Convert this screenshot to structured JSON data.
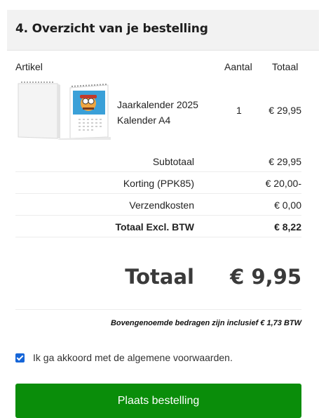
{
  "section": {
    "title": "4. Overzicht van je bestelling"
  },
  "table": {
    "headers": {
      "article": "Artikel",
      "quantity": "Aantal",
      "total": "Totaal"
    },
    "items": [
      {
        "name_line1": "Jaarkalender 2025",
        "name_line2": "Kalender A4",
        "quantity": "1",
        "price": "€ 29,95",
        "image": "wall-calendar-thumbnail"
      }
    ]
  },
  "summary": {
    "subtotal_label": "Subtotaal",
    "subtotal_value": "€ 29,95",
    "discount_label": "Korting (PPK85)",
    "discount_value": "€ 20,00-",
    "shipping_label": "Verzendkosten",
    "shipping_value": "€ 0,00",
    "excl_vat_label": "Totaal Excl. BTW",
    "excl_vat_value": "€ 8,22",
    "total_label": "Totaal",
    "total_value": "€ 9,95"
  },
  "vat_note": "Bovengenoemde bedragen zijn inclusief € 1,73 BTW",
  "terms": {
    "label": "Ik ga akkoord met de algemene voorwaarden.",
    "checked": true
  },
  "submit_button": {
    "label": "Plaats bestelling"
  },
  "colors": {
    "button": "#0a8d0a",
    "checkbox": "#1565d8",
    "header_bg": "#f2f2f2"
  }
}
